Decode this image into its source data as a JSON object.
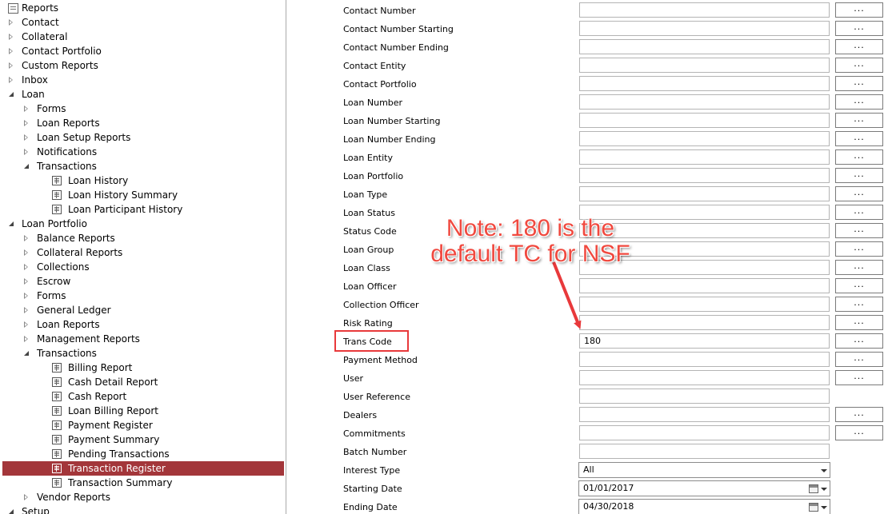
{
  "tree": {
    "items": [
      {
        "label": "Reports",
        "level": 0,
        "kind": "root"
      },
      {
        "label": "Contact",
        "level": 0,
        "kind": "collapsed"
      },
      {
        "label": "Collateral",
        "level": 0,
        "kind": "collapsed"
      },
      {
        "label": "Contact Portfolio",
        "level": 0,
        "kind": "collapsed"
      },
      {
        "label": "Custom Reports",
        "level": 0,
        "kind": "collapsed"
      },
      {
        "label": "Inbox",
        "level": 0,
        "kind": "collapsed"
      },
      {
        "label": "Loan",
        "level": 0,
        "kind": "expanded"
      },
      {
        "label": "Forms",
        "level": 1,
        "kind": "collapsed"
      },
      {
        "label": "Loan Reports",
        "level": 1,
        "kind": "collapsed"
      },
      {
        "label": "Loan Setup Reports",
        "level": 1,
        "kind": "collapsed"
      },
      {
        "label": "Notifications",
        "level": 1,
        "kind": "collapsed"
      },
      {
        "label": "Transactions",
        "level": 1,
        "kind": "expanded"
      },
      {
        "label": "Loan History",
        "level": 2,
        "kind": "report"
      },
      {
        "label": "Loan History Summary",
        "level": 2,
        "kind": "report"
      },
      {
        "label": "Loan Participant History",
        "level": 2,
        "kind": "report"
      },
      {
        "label": "Loan Portfolio",
        "level": 0,
        "kind": "expanded"
      },
      {
        "label": "Balance Reports",
        "level": 1,
        "kind": "collapsed"
      },
      {
        "label": "Collateral Reports",
        "level": 1,
        "kind": "collapsed"
      },
      {
        "label": "Collections",
        "level": 1,
        "kind": "collapsed"
      },
      {
        "label": "Escrow",
        "level": 1,
        "kind": "collapsed"
      },
      {
        "label": "Forms",
        "level": 1,
        "kind": "collapsed"
      },
      {
        "label": "General Ledger",
        "level": 1,
        "kind": "collapsed"
      },
      {
        "label": "Loan Reports",
        "level": 1,
        "kind": "collapsed"
      },
      {
        "label": "Management Reports",
        "level": 1,
        "kind": "collapsed"
      },
      {
        "label": "Transactions",
        "level": 1,
        "kind": "expanded"
      },
      {
        "label": "Billing Report",
        "level": 2,
        "kind": "report"
      },
      {
        "label": "Cash Detail Report",
        "level": 2,
        "kind": "report"
      },
      {
        "label": "Cash Report",
        "level": 2,
        "kind": "report"
      },
      {
        "label": "Loan Billing Report",
        "level": 2,
        "kind": "report"
      },
      {
        "label": "Payment Register",
        "level": 2,
        "kind": "report"
      },
      {
        "label": "Payment Summary",
        "level": 2,
        "kind": "report"
      },
      {
        "label": "Pending Transactions",
        "level": 2,
        "kind": "report"
      },
      {
        "label": "Transaction Register",
        "level": 2,
        "kind": "report",
        "selected": true
      },
      {
        "label": "Transaction Summary",
        "level": 2,
        "kind": "report"
      },
      {
        "label": "Vendor Reports",
        "level": 1,
        "kind": "collapsed"
      },
      {
        "label": "Setup",
        "level": 0,
        "kind": "expanded"
      }
    ]
  },
  "form": {
    "button_label": "...",
    "fields": [
      {
        "label": "Contact Number",
        "value": "",
        "type": "lookup"
      },
      {
        "label": "Contact Number Starting",
        "value": "",
        "type": "lookup"
      },
      {
        "label": "Contact Number Ending",
        "value": "",
        "type": "lookup"
      },
      {
        "label": "Contact Entity",
        "value": "",
        "type": "lookup"
      },
      {
        "label": "Contact Portfolio",
        "value": "",
        "type": "lookup"
      },
      {
        "label": "Loan Number",
        "value": "",
        "type": "lookup"
      },
      {
        "label": "Loan Number Starting",
        "value": "",
        "type": "lookup"
      },
      {
        "label": "Loan Number Ending",
        "value": "",
        "type": "lookup"
      },
      {
        "label": "Loan Entity",
        "value": "",
        "type": "lookup"
      },
      {
        "label": "Loan Portfolio",
        "value": "",
        "type": "lookup"
      },
      {
        "label": "Loan Type",
        "value": "",
        "type": "lookup"
      },
      {
        "label": "Loan Status",
        "value": "",
        "type": "lookup"
      },
      {
        "label": "Status Code",
        "value": "",
        "type": "lookup"
      },
      {
        "label": "Loan Group",
        "value": "",
        "type": "lookup"
      },
      {
        "label": "Loan Class",
        "value": "",
        "type": "lookup"
      },
      {
        "label": "Loan Officer",
        "value": "",
        "type": "lookup"
      },
      {
        "label": "Collection Officer",
        "value": "",
        "type": "lookup"
      },
      {
        "label": "Risk Rating",
        "value": "",
        "type": "lookup"
      },
      {
        "label": "Trans Code",
        "value": "180",
        "type": "lookup"
      },
      {
        "label": "Payment Method",
        "value": "",
        "type": "lookup"
      },
      {
        "label": "User",
        "value": "",
        "type": "lookup"
      },
      {
        "label": "User Reference",
        "value": "",
        "type": "text"
      },
      {
        "label": "Dealers",
        "value": "",
        "type": "lookup"
      },
      {
        "label": "Commitments",
        "value": "",
        "type": "lookup"
      },
      {
        "label": "Batch Number",
        "value": "",
        "type": "text"
      },
      {
        "label": "Interest Type",
        "value": "All",
        "type": "select"
      },
      {
        "label": "Starting Date",
        "value": "01/01/2017",
        "type": "date"
      },
      {
        "label": "Ending Date",
        "value": "04/30/2018",
        "type": "date"
      }
    ]
  },
  "annotation": {
    "line1": "Note: 180 is the",
    "line2": "default TC for NSF",
    "color": "#f0493f"
  },
  "colors": {
    "selection": "#a3363a",
    "highlight_box": "#e8393b"
  }
}
